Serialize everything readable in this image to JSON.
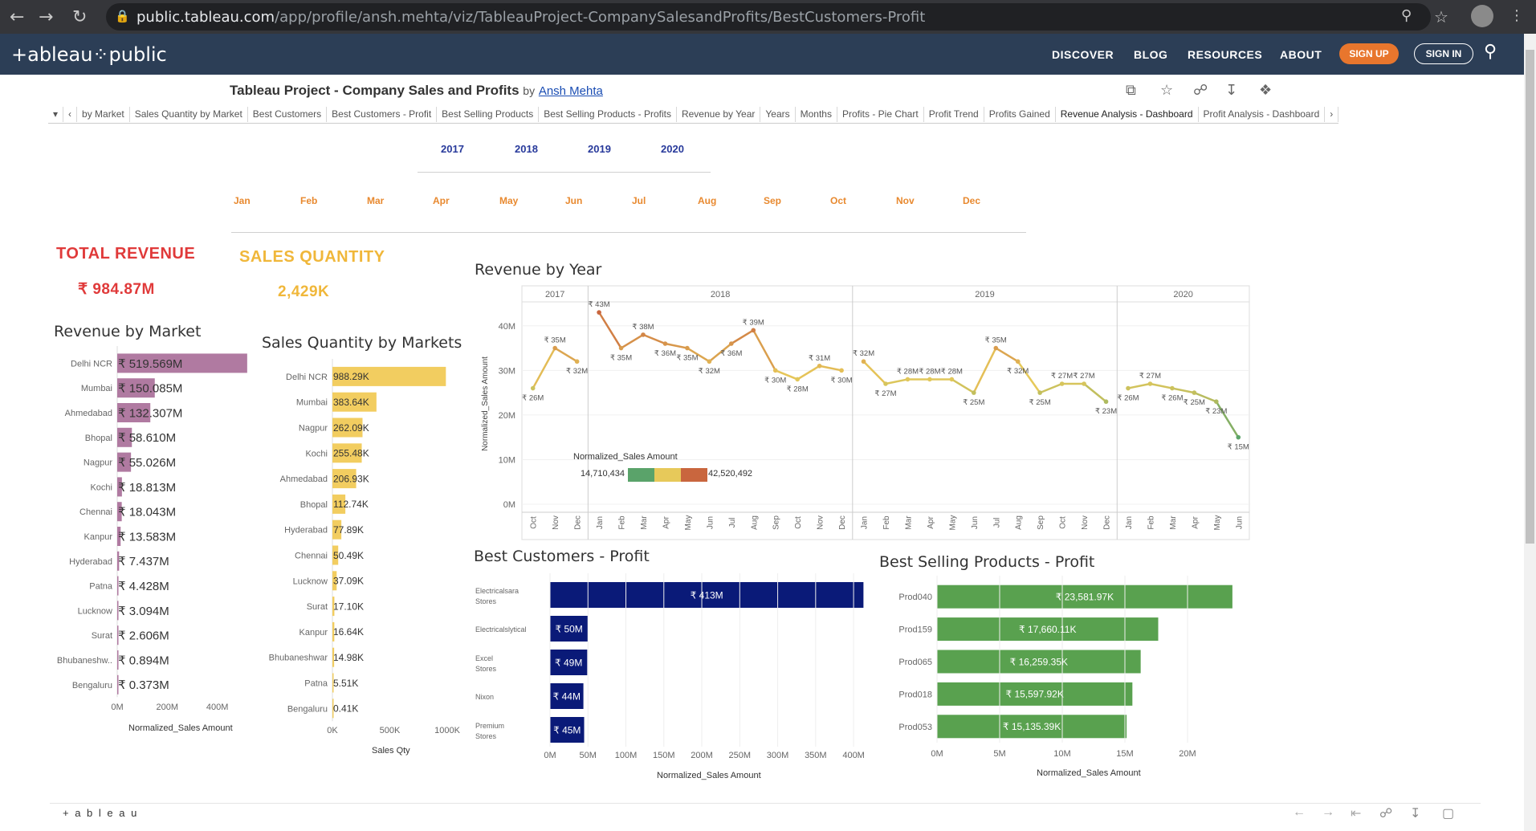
{
  "browser": {
    "url_host": "public.tableau.com",
    "url_path": "/app/profile/ansh.mehta/viz/TableauProject-CompanySalesandProfits/BestCustomers-Profit"
  },
  "header": {
    "logo": "+ableau⁘public",
    "nav": [
      "DISCOVER",
      "BLOG",
      "RESOURCES",
      "ABOUT"
    ],
    "signup": "SIGN UP",
    "signin": "SIGN IN"
  },
  "viz": {
    "title": "Tableau Project - Company Sales and Profits",
    "by": "by",
    "author": "Ansh Mehta"
  },
  "tabs": [
    "by Market",
    "Sales Quantity by Market",
    "Best Customers",
    "Best Customers - Profit",
    "Best Selling Products",
    "Best Selling Products - Profits",
    "Revenue by Year",
    "Years",
    "Months",
    "Profits - Pie Chart",
    "Profit Trend",
    "Profits Gained",
    "Revenue Analysis - Dashboard",
    "Profit Analysis - Dashboard"
  ],
  "active_tab": "Revenue Analysis - Dashboard",
  "filters": {
    "years": [
      "2017",
      "2018",
      "2019",
      "2020"
    ],
    "months": [
      "Jan",
      "Feb",
      "Mar",
      "Apr",
      "May",
      "Jun",
      "Jul",
      "Aug",
      "Sep",
      "Oct",
      "Nov",
      "Dec"
    ]
  },
  "kpis": {
    "total_revenue_label": "TOTAL REVENUE",
    "total_revenue_value": "₹ 984.87M",
    "sales_qty_label": "SALES QUANTITY",
    "sales_qty_value": "2,429K",
    "revenue_color": "#e03a3a",
    "qty_color": "#f0b73a"
  },
  "bottom": {
    "logo": "+ a b l e a u"
  },
  "chart_data": [
    {
      "type": "bar",
      "title": "Revenue by Market",
      "orientation": "horizontal",
      "categories": [
        "Delhi NCR",
        "Mumbai",
        "Ahmedabad",
        "Bhopal",
        "Nagpur",
        "Kochi",
        "Chennai",
        "Kanpur",
        "Hyderabad",
        "Patna",
        "Lucknow",
        "Surat",
        "Bhubaneshw..",
        "Bengaluru"
      ],
      "values": [
        519.569,
        150.085,
        132.307,
        58.61,
        55.026,
        18.813,
        18.043,
        13.583,
        7.437,
        4.428,
        3.094,
        2.606,
        0.894,
        0.373
      ],
      "labels": [
        "₹ 519.569M",
        "₹ 150.085M",
        "₹ 132.307M",
        "₹ 58.610M",
        "₹ 55.026M",
        "₹ 18.813M",
        "₹ 18.043M",
        "₹ 13.583M",
        "₹ 7.437M",
        "₹ 4.428M",
        "₹ 3.094M",
        "₹ 2.606M",
        "₹ 0.894M",
        "₹ 0.373M"
      ],
      "xlabel": "Normalized_Sales Amount",
      "xticks": [
        "0M",
        "200M",
        "400M"
      ],
      "xlim": [
        0,
        520
      ],
      "color": "#b07aa1"
    },
    {
      "type": "bar",
      "title": "Sales Quantity by Markets",
      "orientation": "horizontal",
      "categories": [
        "Delhi NCR",
        "Mumbai",
        "Nagpur",
        "Kochi",
        "Ahmedabad",
        "Bhopal",
        "Hyderabad",
        "Chennai",
        "Lucknow",
        "Surat",
        "Kanpur",
        "Bhubaneshwar",
        "Patna",
        "Bengaluru"
      ],
      "values": [
        988.29,
        383.64,
        262.09,
        255.48,
        206.93,
        112.74,
        77.89,
        50.49,
        37.09,
        17.1,
        16.64,
        14.98,
        5.51,
        0.41
      ],
      "labels": [
        "988.29K",
        "383.64K",
        "262.09K",
        "255.48K",
        "206.93K",
        "112.74K",
        "77.89K",
        "50.49K",
        "37.09K",
        "17.10K",
        "16.64K",
        "14.98K",
        "5.51K",
        "0.41K"
      ],
      "xlabel": "Sales Qty",
      "xticks": [
        "0K",
        "500K",
        "1000K"
      ],
      "xlim": [
        0,
        1000
      ],
      "color": "#f2cd60"
    },
    {
      "type": "line",
      "title": "Revenue by Year",
      "ylabel": "Normalized_Sales Amount",
      "yticks": [
        "0M",
        "10M",
        "20M",
        "30M",
        "40M"
      ],
      "ylim": [
        0,
        45
      ],
      "years": [
        "2017",
        "2018",
        "2019",
        "2020"
      ],
      "year_counts": [
        3,
        12,
        12,
        6
      ],
      "x": [
        "Oct",
        "Nov",
        "Dec",
        "Jan",
        "Feb",
        "Mar",
        "Apr",
        "May",
        "Jun",
        "Jul",
        "Aug",
        "Sep",
        "Oct",
        "Nov",
        "Dec",
        "Jan",
        "Feb",
        "Mar",
        "Apr",
        "May",
        "Jun",
        "Jul",
        "Aug",
        "Sep",
        "Oct",
        "Nov",
        "Dec",
        "Jan",
        "Feb",
        "Mar",
        "Apr",
        "May",
        "Jun"
      ],
      "values": [
        26,
        35,
        32,
        43,
        35,
        38,
        36,
        35,
        32,
        36,
        39,
        30,
        28,
        31,
        30,
        32,
        27,
        28,
        28,
        28,
        25,
        35,
        32,
        25,
        27,
        27,
        23,
        26,
        27,
        26,
        25,
        23,
        15
      ],
      "labels": [
        "₹ 26M",
        "₹ 35M",
        "₹ 32M",
        "₹ 43M",
        "₹ 35M",
        "₹ 38M",
        "₹ 36M",
        "₹ 35M",
        "₹ 32M",
        "₹ 36M",
        "₹ 39M",
        "₹ 30M",
        "₹ 28M",
        "₹ 31M",
        "₹ 30M",
        "₹ 32M",
        "₹ 27M",
        "₹ 28M",
        "₹ 28M",
        "₹ 28M",
        "₹ 25M",
        "₹ 35M",
        "₹ 32M",
        "₹ 25M",
        "₹ 27M",
        "₹ 27M",
        "₹ 23M",
        "₹ 26M",
        "₹ 27M",
        "₹ 26M",
        "₹ 25M",
        "₹ 23M",
        "₹ 15M"
      ],
      "legend_title": "Normalized_Sales Amount",
      "legend_min": "14,710,434",
      "legend_max": "42,520,492",
      "legend_colors": [
        "#5aa36a",
        "#e7c95a",
        "#c9663e"
      ]
    },
    {
      "type": "bar",
      "title": "Best Customers  - Profit",
      "orientation": "horizontal",
      "categories": [
        "Electricalsara Stores",
        "Electricalslytical",
        "Excel Stores",
        "Nixon",
        "Premium Stores"
      ],
      "values": [
        413,
        50,
        49,
        44,
        45
      ],
      "labels": [
        "₹ 413M",
        "₹ 50M",
        "₹ 49M",
        "₹ 44M",
        "₹ 45M"
      ],
      "xlabel": "Normalized_Sales Amount",
      "xticks": [
        "0M",
        "50M",
        "100M",
        "150M",
        "200M",
        "250M",
        "300M",
        "350M",
        "400M"
      ],
      "xlim": [
        0,
        420
      ],
      "color": "#0a1a78"
    },
    {
      "type": "bar",
      "title": "Best Selling Products - Profit",
      "orientation": "horizontal",
      "categories": [
        "Prod040",
        "Prod159",
        "Prod065",
        "Prod018",
        "Prod053"
      ],
      "values": [
        23.58197,
        17.66011,
        16.25935,
        15.59792,
        15.13539
      ],
      "labels": [
        "₹ 23,581.97K",
        "₹ 17,660.11K",
        "₹ 16,259.35K",
        "₹ 15,597.92K",
        "₹ 15,135.39K"
      ],
      "xlabel": "Normalized_Sales Amount",
      "xticks": [
        "0M",
        "5M",
        "10M",
        "15M",
        "20M"
      ],
      "xlim": [
        0,
        25
      ],
      "color": "#59a14f"
    }
  ]
}
